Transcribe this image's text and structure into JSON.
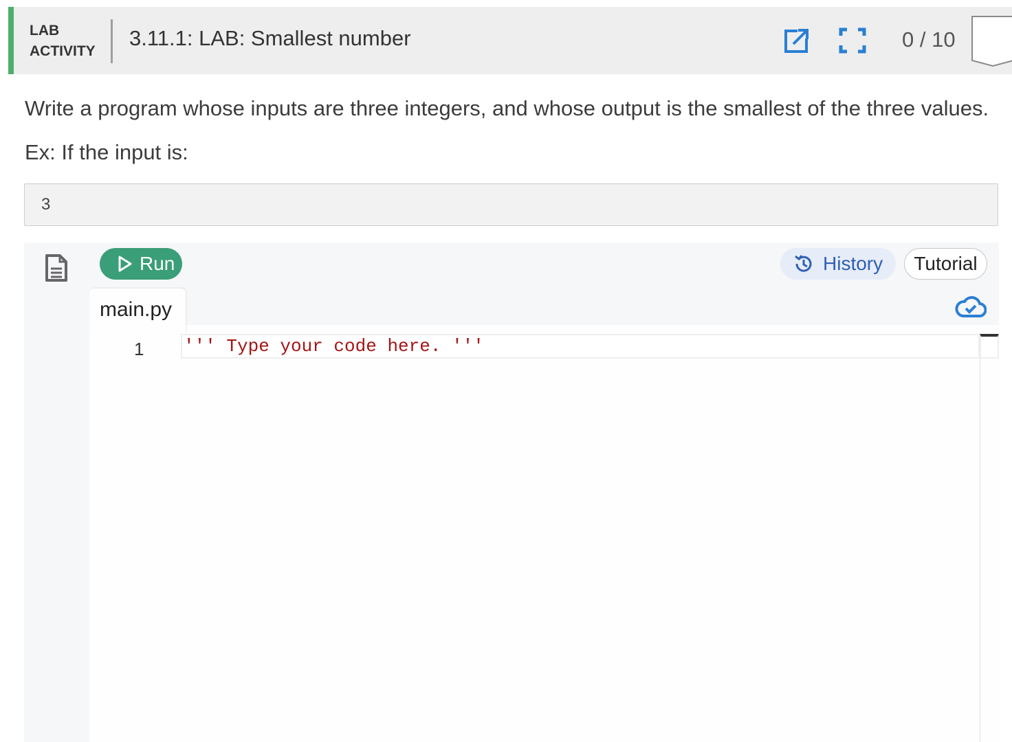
{
  "header": {
    "activity_line1": "LAB",
    "activity_line2": "ACTIVITY",
    "title": "3.11.1: LAB: Smallest number",
    "score": "0 / 10",
    "accent_color": "#4caf6a"
  },
  "content": {
    "instructions": "Write a program whose inputs are three integers, and whose output is the smallest of the three values.",
    "example_label": "Ex: If the input is:",
    "example_input": "3"
  },
  "toolbar": {
    "run_label": "Run",
    "history_label": "History",
    "tutorial_label": "Tutorial",
    "run_color": "#3a9e78",
    "history_color": "#2f5fb3"
  },
  "editor": {
    "file_name": "main.py",
    "lines": [
      {
        "number": "1",
        "code": "''' Type your code here. '''"
      }
    ]
  },
  "icons": {
    "open": "open-external-icon",
    "fullscreen": "fullscreen-icon",
    "badge": "completion-badge-icon",
    "file": "file-document-icon",
    "play": "play-icon",
    "history": "history-icon",
    "cloud": "cloud-saved-icon"
  }
}
